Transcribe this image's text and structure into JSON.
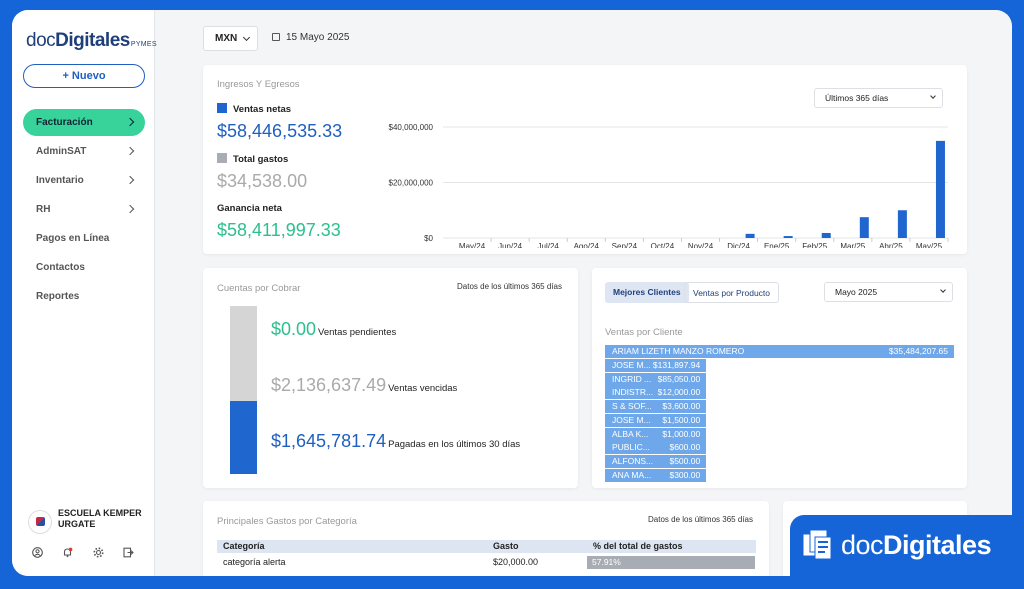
{
  "brand": {
    "doc": "doc",
    "digitales": "Digitales",
    "pymes": "PYMES"
  },
  "sidebar": {
    "new_button": "+ Nuevo",
    "items": [
      {
        "label": "Facturación",
        "has_chevron": true,
        "active": true
      },
      {
        "label": "AdminSAT",
        "has_chevron": true
      },
      {
        "label": "Inventario",
        "has_chevron": true
      },
      {
        "label": "RH",
        "has_chevron": true
      },
      {
        "label": "Pagos en Línea"
      },
      {
        "label": "Contactos"
      },
      {
        "label": "Reportes"
      }
    ],
    "company": "ESCUELA KEMPER URGATE",
    "bottom_icons": [
      "user-icon",
      "bell-icon",
      "gear-icon",
      "logout-icon"
    ]
  },
  "topbar": {
    "currency": "MXN",
    "date": "15 Mayo 2025"
  },
  "ingresos": {
    "title": "Ingresos Y Egresos",
    "ventas_label": "Ventas netas",
    "ventas_value": "$58,446,535.33",
    "gastos_label": "Total gastos",
    "gastos_value": "$34,538.00",
    "ganancia_label": "Ganancia neta",
    "ganancia_value": "$58,411,997.33",
    "range": "Últimos 365 días"
  },
  "chart_data": {
    "type": "bar",
    "categories": [
      "May/24",
      "Jun/24",
      "Jul/24",
      "Ago/24",
      "Sep/24",
      "Oct/24",
      "Nov/24",
      "Dic/24",
      "Ene/25",
      "Feb/25",
      "Mar/25",
      "Abr/25",
      "May/25"
    ],
    "values": [
      0,
      0,
      0,
      0,
      0,
      0,
      0,
      1500000,
      700000,
      1800000,
      7500000,
      10000000,
      35000000
    ],
    "y_ticks": [
      "$0",
      "$20,000,000",
      "$40,000,000"
    ],
    "ylim": [
      0,
      40000000
    ],
    "grid": true,
    "color": "#1f66cf"
  },
  "cuentas": {
    "title": "Cuentas por Cobrar",
    "note": "Datos de los últimos 365 días",
    "pendientes_value": "$0.00",
    "pendientes_label": "Ventas pendientes",
    "vencidas_value": "$2,136,637.49",
    "vencidas_label": "Ventas vencidas",
    "pagadas_value": "$1,645,781.74",
    "pagadas_label": "Pagadas en los últimos 30 días",
    "paid_fraction": 0.435
  },
  "ventas_cliente": {
    "tab_active": "Mejores Clientes",
    "tab_inactive": "Ventas por Producto",
    "month": "Mayo 2025",
    "subtitle": "Ventas por Cliente",
    "rows": [
      {
        "name": "ARIAM LIZETH MANZO ROMERO",
        "amount": "$35,484,207.65",
        "fraction": 1.0
      },
      {
        "name": "JOSE M...",
        "amount": "$131,897.94",
        "fraction": 0.29
      },
      {
        "name": "INGRID ...",
        "amount": "$85,050.00",
        "fraction": 0.29
      },
      {
        "name": "INDISTR...",
        "amount": "$12,000.00",
        "fraction": 0.29
      },
      {
        "name": "S & SOF...",
        "amount": "$3,600.00",
        "fraction": 0.29
      },
      {
        "name": "JOSE M...",
        "amount": "$1,500.00",
        "fraction": 0.29
      },
      {
        "name": "ALBA K...",
        "amount": "$1,000.00",
        "fraction": 0.29
      },
      {
        "name": "PUBLIC...",
        "amount": "$600.00",
        "fraction": 0.29
      },
      {
        "name": "ALFONS...",
        "amount": "$500.00",
        "fraction": 0.29
      },
      {
        "name": "ANA MA...",
        "amount": "$300.00",
        "fraction": 0.29
      }
    ]
  },
  "gastos": {
    "title": "Principales Gastos por Categoría",
    "note": "Datos de los últimos 365 días",
    "headers": [
      "Categoría",
      "Gasto",
      "% del total de gastos"
    ],
    "rows": [
      {
        "categoria": "categoría alerta",
        "gasto": "$20,000.00",
        "pct": "57.91%"
      }
    ]
  },
  "badge": {
    "doc": "doc",
    "digitales": "Digitales"
  }
}
